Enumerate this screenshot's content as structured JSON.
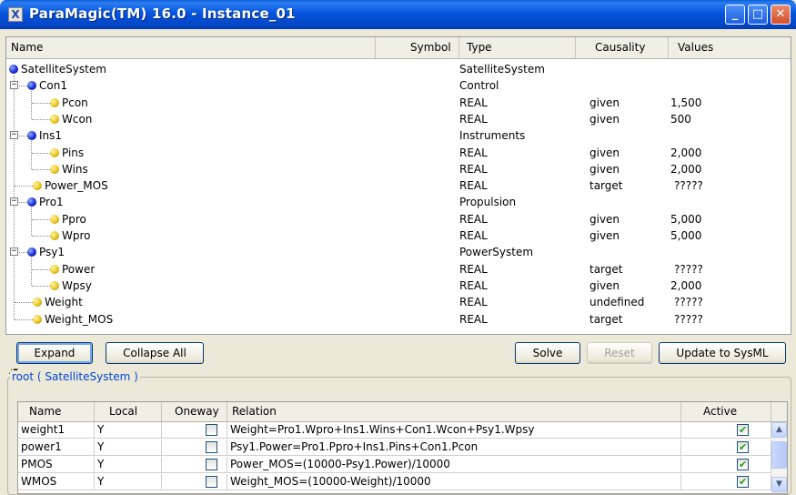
{
  "window": {
    "title": "ParaMagic(TM) 16.0 - Instance_01",
    "icon_glyph": "X",
    "controls": {
      "minimize": "_",
      "maximize": "□",
      "close": "✕"
    }
  },
  "tree": {
    "headers": {
      "name": "Name",
      "symbol": "Symbol",
      "type": "Type",
      "causality": "Causality",
      "values": "Values"
    },
    "rows": [
      {
        "name": "SatelliteSystem",
        "symbol": "",
        "type": "SatelliteSystem",
        "causality": "",
        "value": ""
      },
      {
        "name": "Con1",
        "symbol": "",
        "type": "Control",
        "causality": "",
        "value": ""
      },
      {
        "name": "Pcon",
        "symbol": "",
        "type": "REAL",
        "causality": "given",
        "value": "1,500"
      },
      {
        "name": "Wcon",
        "symbol": "",
        "type": "REAL",
        "causality": "given",
        "value": "500"
      },
      {
        "name": "Ins1",
        "symbol": "",
        "type": "Instruments",
        "causality": "",
        "value": ""
      },
      {
        "name": "Pins",
        "symbol": "",
        "type": "REAL",
        "causality": "given",
        "value": "2,000"
      },
      {
        "name": "Wins",
        "symbol": "",
        "type": "REAL",
        "causality": "given",
        "value": "2,000"
      },
      {
        "name": "Power_MOS",
        "symbol": "",
        "type": "REAL",
        "causality": "target",
        "value": "?????"
      },
      {
        "name": "Pro1",
        "symbol": "",
        "type": "Propulsion",
        "causality": "",
        "value": ""
      },
      {
        "name": "Ppro",
        "symbol": "",
        "type": "REAL",
        "causality": "given",
        "value": "5,000"
      },
      {
        "name": "Wpro",
        "symbol": "",
        "type": "REAL",
        "causality": "given",
        "value": "5,000"
      },
      {
        "name": "Psy1",
        "symbol": "",
        "type": "PowerSystem",
        "causality": "",
        "value": ""
      },
      {
        "name": "Power",
        "symbol": "",
        "type": "REAL",
        "causality": "target",
        "value": "?????"
      },
      {
        "name": "Wpsy",
        "symbol": "",
        "type": "REAL",
        "causality": "given",
        "value": "2,000"
      },
      {
        "name": "Weight",
        "symbol": "",
        "type": "REAL",
        "causality": "undefined",
        "value": "?????"
      },
      {
        "name": "Weight_MOS",
        "symbol": "",
        "type": "REAL",
        "causality": "target",
        "value": "?????"
      }
    ],
    "expander_glyph": "−"
  },
  "buttons": {
    "expand": "Expand",
    "collapse_all": "Collapse All",
    "solve": "Solve",
    "reset": "Reset",
    "update": "Update to SysML"
  },
  "splitter_glyph": "▲▼",
  "relations": {
    "group_title": "root ( SatelliteSystem )",
    "headers": {
      "name": "Name",
      "local": "Local",
      "oneway": "Oneway",
      "relation": "Relation",
      "active": "Active"
    },
    "rows": [
      {
        "name": "weight1",
        "local": "Y",
        "oneway": false,
        "relation": "Weight=Pro1.Wpro+Ins1.Wins+Con1.Wcon+Psy1.Wpsy",
        "active": true
      },
      {
        "name": "power1",
        "local": "Y",
        "oneway": false,
        "relation": "Psy1.Power=Pro1.Ppro+Ins1.Pins+Con1.Pcon",
        "active": true
      },
      {
        "name": "PMOS",
        "local": "Y",
        "oneway": false,
        "relation": "Power_MOS=(10000-Psy1.Power)/10000",
        "active": true
      },
      {
        "name": "WMOS",
        "local": "Y",
        "oneway": false,
        "relation": "Weight_MOS=(10000-Weight)/10000",
        "active": true
      }
    ],
    "scroll_up": "▲",
    "scroll_down": "▼"
  }
}
